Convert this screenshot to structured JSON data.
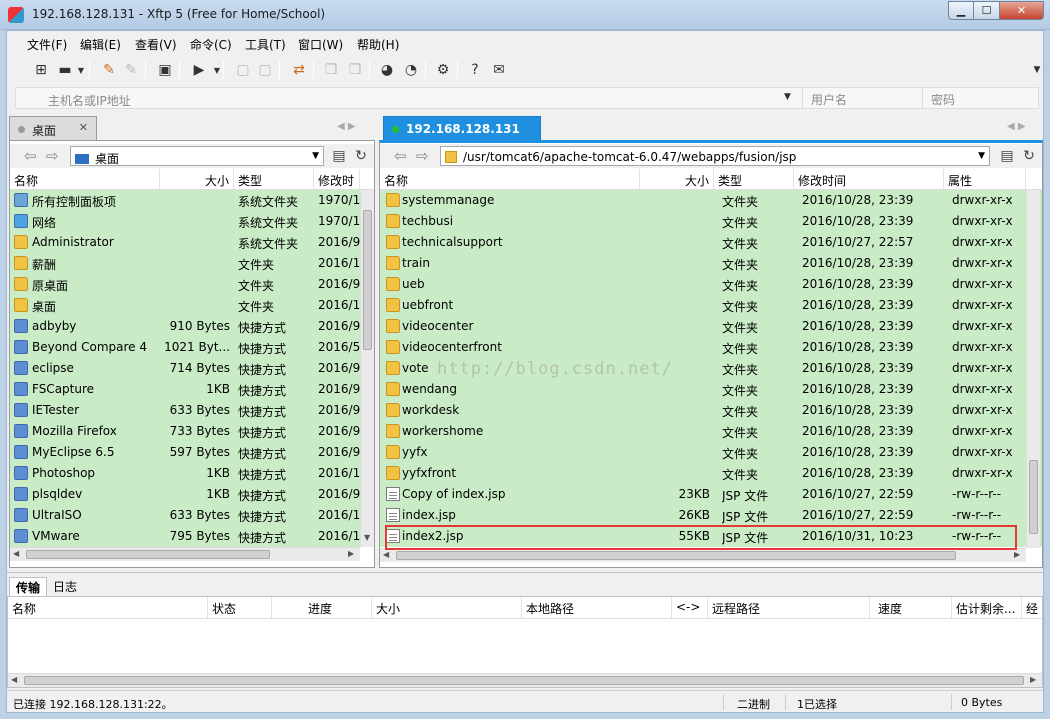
{
  "window": {
    "title": "192.168.128.131   - Xftp 5 (Free for Home/School)"
  },
  "menu": [
    "文件(F)",
    "编辑(E)",
    "查看(V)",
    "命令(C)",
    "工具(T)",
    "窗口(W)",
    "帮助(H)"
  ],
  "address": {
    "host_placeholder": "主机名或IP地址",
    "user_placeholder": "用户名",
    "pass_placeholder": "密码"
  },
  "left": {
    "tab": "桌面",
    "path": "桌面",
    "columns": [
      "名称",
      "大小",
      "类型",
      "修改时"
    ],
    "rows": [
      {
        "name": "所有控制面板项",
        "size": "",
        "type": "系统文件夹",
        "date": "1970/1",
        "icon": "control-panel"
      },
      {
        "name": "网络",
        "size": "",
        "type": "系统文件夹",
        "date": "1970/1",
        "icon": "network"
      },
      {
        "name": "Administrator",
        "size": "",
        "type": "系统文件夹",
        "date": "2016/9",
        "icon": "folder"
      },
      {
        "name": "薪酬",
        "size": "",
        "type": "文件夹",
        "date": "2016/1",
        "icon": "folder"
      },
      {
        "name": "原桌面",
        "size": "",
        "type": "文件夹",
        "date": "2016/9",
        "icon": "folder"
      },
      {
        "name": "桌面",
        "size": "",
        "type": "文件夹",
        "date": "2016/1",
        "icon": "folder"
      },
      {
        "name": "adbyby",
        "size": "910 Bytes",
        "type": "快捷方式",
        "date": "2016/9",
        "icon": "shortcut"
      },
      {
        "name": "Beyond Compare 4",
        "size": "1021 Byt...",
        "type": "快捷方式",
        "date": "2016/5",
        "icon": "shortcut"
      },
      {
        "name": "eclipse",
        "size": "714 Bytes",
        "type": "快捷方式",
        "date": "2016/9",
        "icon": "shortcut"
      },
      {
        "name": "FSCapture",
        "size": "1KB",
        "type": "快捷方式",
        "date": "2016/9",
        "icon": "shortcut"
      },
      {
        "name": "IETester",
        "size": "633 Bytes",
        "type": "快捷方式",
        "date": "2016/9",
        "icon": "shortcut"
      },
      {
        "name": "Mozilla Firefox",
        "size": "733 Bytes",
        "type": "快捷方式",
        "date": "2016/9",
        "icon": "shortcut"
      },
      {
        "name": "MyEclipse 6.5",
        "size": "597 Bytes",
        "type": "快捷方式",
        "date": "2016/9",
        "icon": "shortcut"
      },
      {
        "name": "Photoshop",
        "size": "1KB",
        "type": "快捷方式",
        "date": "2016/1",
        "icon": "shortcut"
      },
      {
        "name": "plsqldev",
        "size": "1KB",
        "type": "快捷方式",
        "date": "2016/9",
        "icon": "shortcut"
      },
      {
        "name": "UltraISO",
        "size": "633 Bytes",
        "type": "快捷方式",
        "date": "2016/1",
        "icon": "shortcut"
      },
      {
        "name": "VMware",
        "size": "795 Bytes",
        "type": "快捷方式",
        "date": "2016/1",
        "icon": "shortcut"
      }
    ]
  },
  "right": {
    "tab": "192.168.128.131",
    "path": "/usr/tomcat6/apache-tomcat-6.0.47/webapps/fusion/jsp",
    "columns": [
      "名称",
      "大小",
      "类型",
      "修改时间",
      "属性"
    ],
    "rows": [
      {
        "name": "systemmanage",
        "size": "",
        "type": "文件夹",
        "date": "2016/10/28, 23:39",
        "attr": "drwxr-xr-x",
        "icon": "folder"
      },
      {
        "name": "techbusi",
        "size": "",
        "type": "文件夹",
        "date": "2016/10/28, 23:39",
        "attr": "drwxr-xr-x",
        "icon": "folder"
      },
      {
        "name": "technicalsupport",
        "size": "",
        "type": "文件夹",
        "date": "2016/10/27, 22:57",
        "attr": "drwxr-xr-x",
        "icon": "folder"
      },
      {
        "name": "train",
        "size": "",
        "type": "文件夹",
        "date": "2016/10/28, 23:39",
        "attr": "drwxr-xr-x",
        "icon": "folder"
      },
      {
        "name": "ueb",
        "size": "",
        "type": "文件夹",
        "date": "2016/10/28, 23:39",
        "attr": "drwxr-xr-x",
        "icon": "folder"
      },
      {
        "name": "uebfront",
        "size": "",
        "type": "文件夹",
        "date": "2016/10/28, 23:39",
        "attr": "drwxr-xr-x",
        "icon": "folder"
      },
      {
        "name": "videocenter",
        "size": "",
        "type": "文件夹",
        "date": "2016/10/28, 23:39",
        "attr": "drwxr-xr-x",
        "icon": "folder"
      },
      {
        "name": "videocenterfront",
        "size": "",
        "type": "文件夹",
        "date": "2016/10/28, 23:39",
        "attr": "drwxr-xr-x",
        "icon": "folder"
      },
      {
        "name": "vote",
        "size": "",
        "type": "文件夹",
        "date": "2016/10/28, 23:39",
        "attr": "drwxr-xr-x",
        "icon": "folder"
      },
      {
        "name": "wendang",
        "size": "",
        "type": "文件夹",
        "date": "2016/10/28, 23:39",
        "attr": "drwxr-xr-x",
        "icon": "folder"
      },
      {
        "name": "workdesk",
        "size": "",
        "type": "文件夹",
        "date": "2016/10/28, 23:39",
        "attr": "drwxr-xr-x",
        "icon": "folder"
      },
      {
        "name": "workershome",
        "size": "",
        "type": "文件夹",
        "date": "2016/10/28, 23:39",
        "attr": "drwxr-xr-x",
        "icon": "folder"
      },
      {
        "name": "yyfx",
        "size": "",
        "type": "文件夹",
        "date": "2016/10/28, 23:39",
        "attr": "drwxr-xr-x",
        "icon": "folder"
      },
      {
        "name": "yyfxfront",
        "size": "",
        "type": "文件夹",
        "date": "2016/10/28, 23:39",
        "attr": "drwxr-xr-x",
        "icon": "folder"
      },
      {
        "name": "Copy of index.jsp",
        "size": "23KB",
        "type": "JSP 文件",
        "date": "2016/10/27, 22:59",
        "attr": "-rw-r--r--",
        "icon": "file"
      },
      {
        "name": "index.jsp",
        "size": "26KB",
        "type": "JSP 文件",
        "date": "2016/10/27, 22:59",
        "attr": "-rw-r--r--",
        "icon": "file"
      },
      {
        "name": "index2.jsp",
        "size": "55KB",
        "type": "JSP 文件",
        "date": "2016/10/31, 10:23",
        "attr": "-rw-r--r--",
        "icon": "file"
      }
    ]
  },
  "watermark": "http://blog.csdn.net/",
  "transfer": {
    "tabs": [
      "传输",
      "日志"
    ],
    "columns": [
      "名称",
      "状态",
      "进度",
      "大小",
      "本地路径",
      "<->",
      "远程路径",
      "速度",
      "估计剩余...",
      "经"
    ]
  },
  "status": {
    "connected": "已连接 192.168.128.131:22。",
    "mode": "二进制",
    "selected": "1已选择",
    "bytes": "0 Bytes"
  },
  "colors": {
    "selected_row": "#c9ebc6",
    "active_tab": "#1e90df",
    "highlight": "#e53935"
  }
}
